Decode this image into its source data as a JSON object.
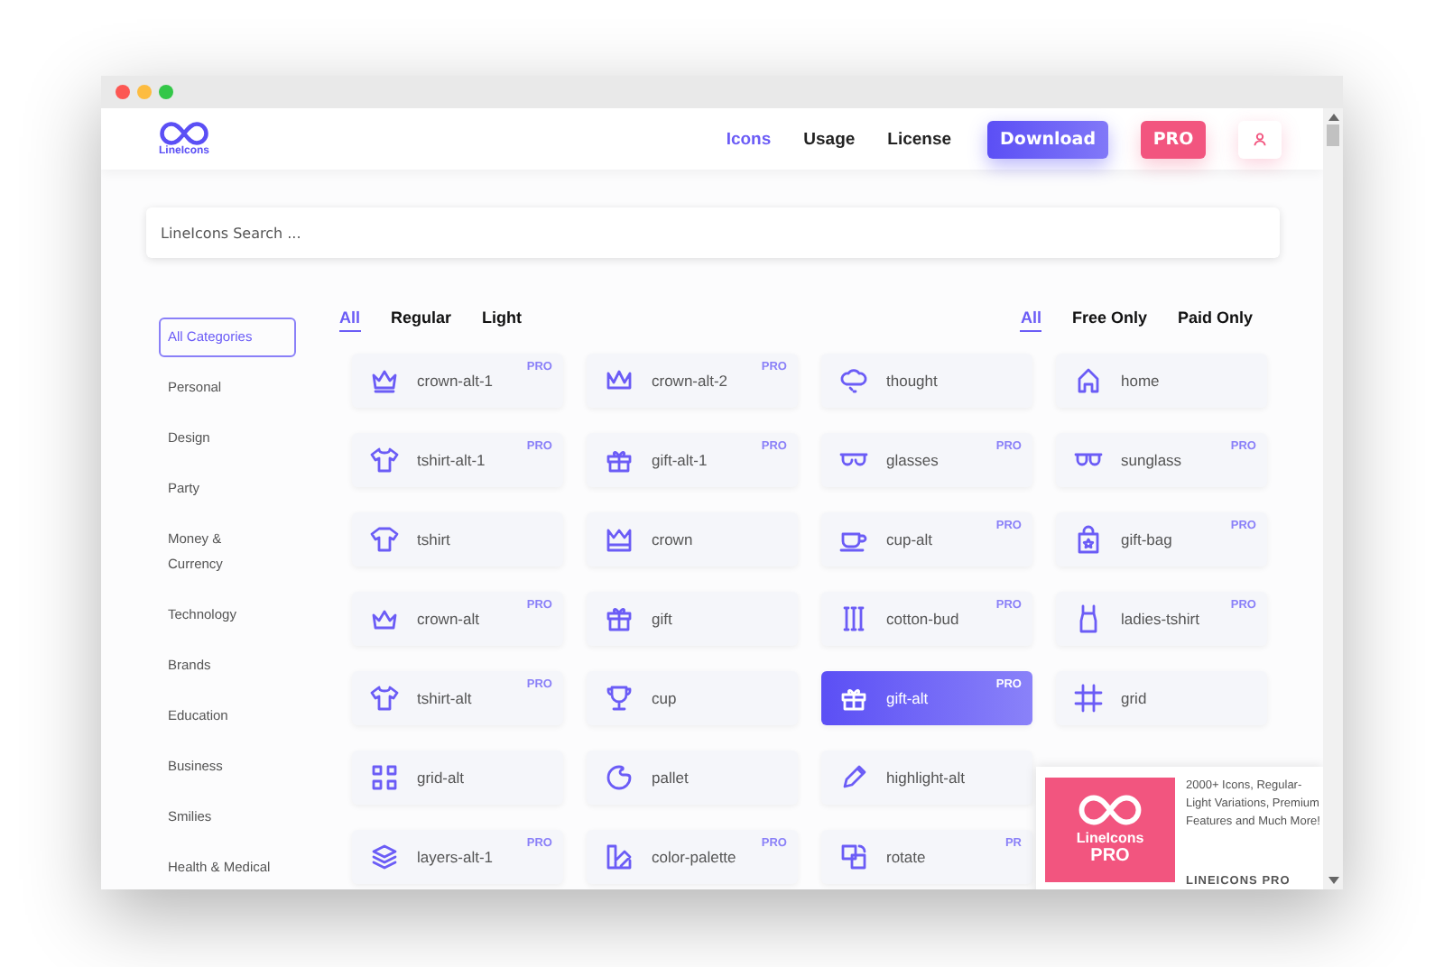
{
  "header": {
    "logo_text": "LineIcons",
    "nav": [
      {
        "label": "Icons",
        "selected": true
      },
      {
        "label": "Usage",
        "selected": false
      },
      {
        "label": "License",
        "selected": false
      }
    ],
    "download_button": "Download",
    "pro_button": "PRO"
  },
  "search": {
    "placeholder": "LineIcons Search ..."
  },
  "sidebar": {
    "items": [
      {
        "label": "All Categories",
        "selected": true
      },
      {
        "label": "Personal",
        "selected": false
      },
      {
        "label": "Design",
        "selected": false
      },
      {
        "label": "Party",
        "selected": false
      },
      {
        "label": "Money & Currency",
        "selected": false
      },
      {
        "label": "Technology",
        "selected": false
      },
      {
        "label": "Brands",
        "selected": false
      },
      {
        "label": "Education",
        "selected": false
      },
      {
        "label": "Business",
        "selected": false
      },
      {
        "label": "Smilies",
        "selected": false
      },
      {
        "label": "Health & Medical",
        "selected": false
      }
    ]
  },
  "style_tabs": [
    {
      "label": "All",
      "selected": true
    },
    {
      "label": "Regular",
      "selected": false
    },
    {
      "label": "Light",
      "selected": false
    }
  ],
  "price_tabs": [
    {
      "label": "All",
      "selected": true
    },
    {
      "label": "Free Only",
      "selected": false
    },
    {
      "label": "Paid Only",
      "selected": false
    }
  ],
  "icon_rows": [
    {
      "tiles": [
        {
          "label": "crown-alt-1",
          "badge": "PRO",
          "selected": false
        },
        {
          "label": "crown-alt-2",
          "badge": "PRO",
          "selected": false
        },
        {
          "label": "thought",
          "selected": false
        },
        {
          "label": "home",
          "selected": false
        }
      ]
    },
    {
      "tiles": [
        {
          "label": "tshirt-alt-1",
          "badge": "PRO",
          "selected": false
        },
        {
          "label": "gift-alt-1",
          "badge": "PRO",
          "selected": false
        },
        {
          "label": "glasses",
          "badge": "PRO",
          "selected": false
        },
        {
          "label": "sunglass",
          "badge": "PRO",
          "selected": false
        }
      ]
    },
    {
      "tiles": [
        {
          "label": "tshirt",
          "selected": false
        },
        {
          "label": "crown",
          "selected": false
        },
        {
          "label": "cup-alt",
          "badge": "PRO",
          "selected": false
        },
        {
          "label": "gift-bag",
          "badge": "PRO",
          "selected": false
        }
      ]
    },
    {
      "tiles": [
        {
          "label": "crown-alt",
          "badge": "PRO",
          "selected": false
        },
        {
          "label": "gift",
          "selected": false
        },
        {
          "label": "cotton-bud",
          "badge": "PRO",
          "selected": false
        },
        {
          "label": "ladies-tshirt",
          "badge": "PRO",
          "selected": false
        }
      ]
    },
    {
      "tiles": [
        {
          "label": "tshirt-alt",
          "badge": "PRO",
          "selected": false
        },
        {
          "label": "cup",
          "selected": false
        },
        {
          "label": "gift-alt",
          "badge": "PRO",
          "selected": true
        },
        {
          "label": "grid",
          "selected": false
        }
      ]
    },
    {
      "tiles": [
        {
          "label": "grid-alt",
          "selected": false
        },
        {
          "label": "pallet",
          "selected": false
        },
        {
          "label": "highlight-alt",
          "selected": false
        }
      ]
    },
    {
      "tiles": [
        {
          "label": "layers-alt-1",
          "badge": "PRO",
          "selected": false
        },
        {
          "label": "color-palette",
          "badge": "PRO",
          "selected": false
        },
        {
          "label": "rotate",
          "badge": "PR",
          "selected": false
        }
      ]
    }
  ],
  "promo": {
    "logo_text": "LineIcons",
    "logo_badge": "PRO",
    "description": "2000+ Icons, Regular-Light Variations, Premium Features and Much More!",
    "caption": "LINEICONS PRO"
  }
}
